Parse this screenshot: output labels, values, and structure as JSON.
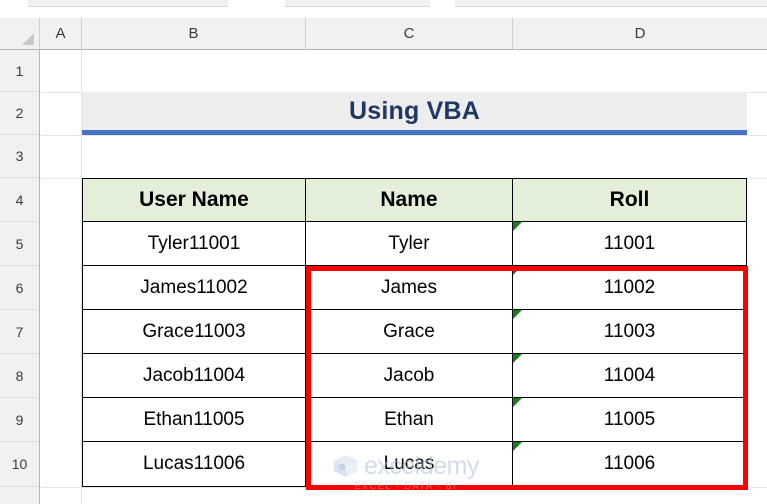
{
  "app": {
    "name": "spreadsheet",
    "select_all_label": "Select All"
  },
  "columns": {
    "headers": [
      "A",
      "B",
      "C",
      "D"
    ]
  },
  "rows": {
    "headers": [
      "1",
      "2",
      "3",
      "4",
      "5",
      "6",
      "7",
      "8",
      "9",
      "10"
    ]
  },
  "title_banner": {
    "text": "Using VBA",
    "text_color": "#1F3864",
    "background": "#EDEDED",
    "accent_color": "#4472C4"
  },
  "table": {
    "header_background": "#E4EFD9",
    "headers": [
      "User Name",
      "Name",
      "Roll"
    ],
    "rows": [
      {
        "user_name": "Tyler11001",
        "name": "Tyler",
        "roll": "11001"
      },
      {
        "user_name": "James11002",
        "name": "James",
        "roll": "11002"
      },
      {
        "user_name": "Grace11003",
        "name": "Grace",
        "roll": "11003"
      },
      {
        "user_name": "Jacob11004",
        "name": "Jacob",
        "roll": "11004"
      },
      {
        "user_name": "Ethan11005",
        "name": "Ethan",
        "roll": "11005"
      },
      {
        "user_name": "Lucas11006",
        "name": "Lucas",
        "roll": "11006"
      }
    ]
  },
  "annotation": {
    "highlight_color": "#FF0000",
    "error_indicator_color": "#1E7B1E"
  },
  "watermark": {
    "word": "exceldemy",
    "tagline": "EXCEL - DATA - BI",
    "color": "#AEBFD8"
  }
}
